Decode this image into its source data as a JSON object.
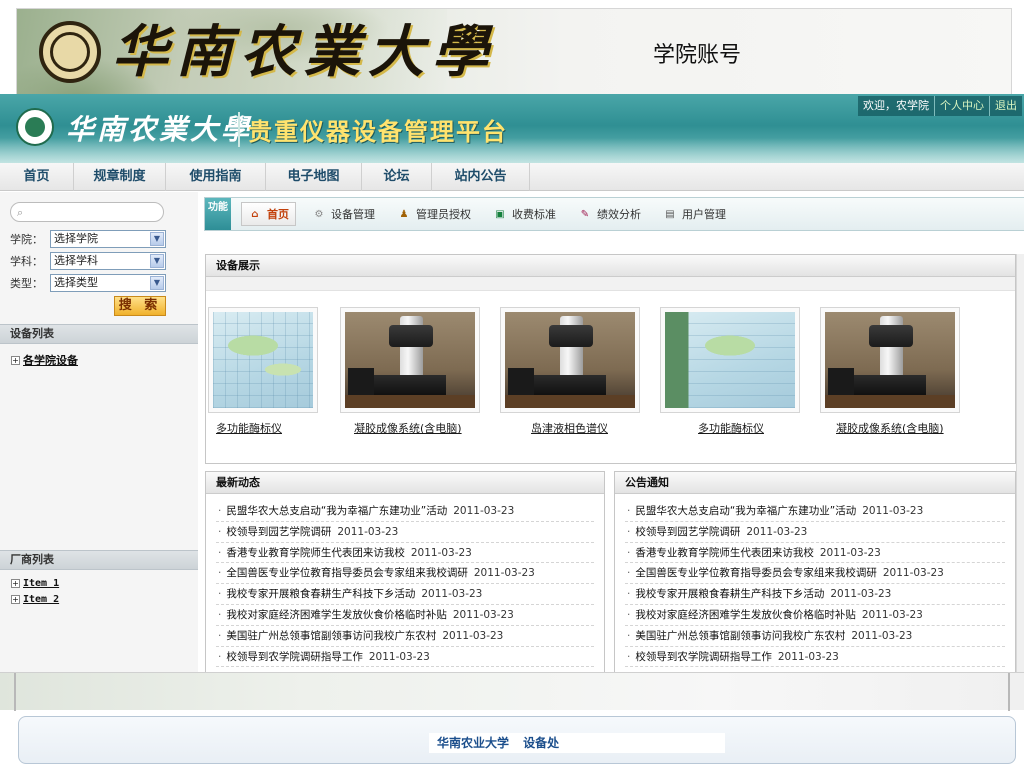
{
  "banner": {
    "calligraphy": "华南农業大學",
    "account_label": "学院账号"
  },
  "header": {
    "brand": "华南农業大學",
    "platform_title": "贵重仪器设备管理平台",
    "welcome": "欢迎，农学院",
    "profile_link": "个人中心",
    "logout_link": "退出"
  },
  "nav": {
    "items": [
      "首页",
      "规章制度",
      "使用指南",
      "电子地图",
      "论坛",
      "站内公告"
    ]
  },
  "sidebar": {
    "search_placeholder": "",
    "filters": [
      {
        "label": "学院：",
        "value": "选择学院"
      },
      {
        "label": "学科：",
        "value": "选择学科"
      },
      {
        "label": "类型：",
        "value": "选择类型"
      }
    ],
    "search_button": "搜 索",
    "equipment_section": "设备列表",
    "equipment_tree": [
      "各学院设备"
    ],
    "vendor_section": "厂商列表",
    "vendor_tree": [
      "Item 1",
      "Item 2"
    ]
  },
  "function_bar": {
    "tag": "功能",
    "items": [
      {
        "label": "首页",
        "icon": "home-icon",
        "active": true
      },
      {
        "label": "设备管理",
        "icon": "gear-icon",
        "active": false
      },
      {
        "label": "管理员授权",
        "icon": "users-icon",
        "active": false
      },
      {
        "label": "收费标准",
        "icon": "money-icon",
        "active": false
      },
      {
        "label": "绩效分析",
        "icon": "chart-icon",
        "active": false
      },
      {
        "label": "用户管理",
        "icon": "user-manage-icon",
        "active": false
      }
    ]
  },
  "equipment": {
    "title": "设备展示",
    "items": [
      {
        "name": "多功能酶标仪",
        "image": "map-image"
      },
      {
        "name": "凝胶成像系统(含电脑)",
        "image": "instrument-image"
      },
      {
        "name": "岛津液相色谱仪",
        "image": "instrument-image"
      },
      {
        "name": "多功能酶标仪",
        "image": "map-image"
      },
      {
        "name": "凝胶成像系统(含电脑)",
        "image": "instrument-image"
      }
    ]
  },
  "news": {
    "title": "最新动态",
    "items": [
      {
        "title": "民盟华农大总支启动“我为幸福广东建功业”活动",
        "date": "2011-03-23"
      },
      {
        "title": "校领导到园艺学院调研",
        "date": "2011-03-23"
      },
      {
        "title": "香港专业教育学院师生代表团来访我校",
        "date": "2011-03-23"
      },
      {
        "title": "全国兽医专业学位教育指导委员会专家组来我校调研",
        "date": "2011-03-23"
      },
      {
        "title": "我校专家开展粮食春耕生产科技下乡活动",
        "date": "2011-03-23"
      },
      {
        "title": "我校对家庭经济困难学生发放伙食价格临时补贴",
        "date": "2011-03-23"
      },
      {
        "title": "美国驻广州总领事馆副领事访问我校广东农村",
        "date": "2011-03-23"
      },
      {
        "title": "校领导到农学院调研指导工作",
        "date": "2011-03-23"
      }
    ]
  },
  "notices": {
    "title": "公告通知",
    "items": [
      {
        "title": "民盟华农大总支启动“我为幸福广东建功业”活动",
        "date": "2011-03-23"
      },
      {
        "title": "校领导到园艺学院调研",
        "date": "2011-03-23"
      },
      {
        "title": "香港专业教育学院师生代表团来访我校",
        "date": "2011-03-23"
      },
      {
        "title": "全国兽医专业学位教育指导委员会专家组来我校调研",
        "date": "2011-03-23"
      },
      {
        "title": "我校专家开展粮食春耕生产科技下乡活动",
        "date": "2011-03-23"
      },
      {
        "title": "我校对家庭经济困难学生发放伙食价格临时补贴",
        "date": "2011-03-23"
      },
      {
        "title": "美国驻广州总领事馆副领事访问我校广东农村",
        "date": "2011-03-23"
      },
      {
        "title": "校领导到农学院调研指导工作",
        "date": "2011-03-23"
      }
    ]
  },
  "footer": {
    "text": "华南农业大学  设备处"
  },
  "colors": {
    "header_teal": "#2f8f93",
    "title_yellow": "#ffe36e",
    "nav_text": "#1e4c6a",
    "search_button": "#f0b12c",
    "active_tab": "#c2410c"
  }
}
